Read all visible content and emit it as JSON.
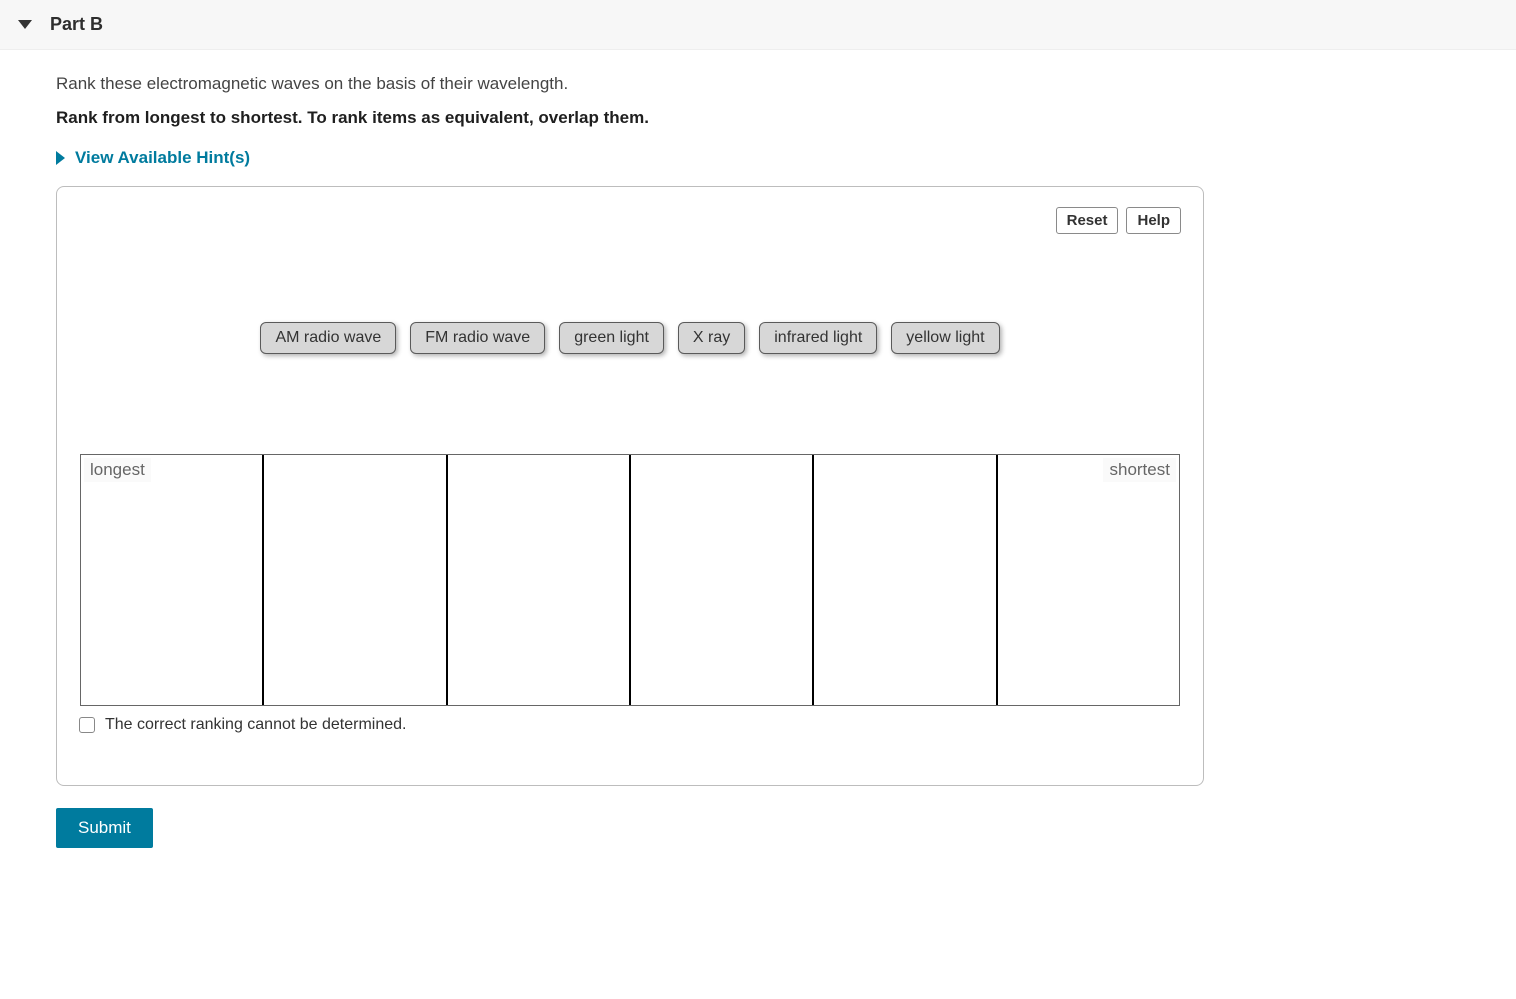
{
  "part": {
    "title": "Part B"
  },
  "question": {
    "prompt": "Rank these electromagnetic waves on the basis of their wavelength.",
    "instruction": "Rank from longest to shortest. To rank items as equivalent, overlap them."
  },
  "hints": {
    "label": "View Available Hint(s)"
  },
  "toolbar": {
    "reset": "Reset",
    "help": "Help"
  },
  "items": [
    "AM radio wave",
    "FM radio wave",
    "green light",
    "X ray",
    "infrared light",
    "yellow light"
  ],
  "ranking": {
    "left_label": "longest",
    "right_label": "shortest",
    "slots": 6
  },
  "checkbox": {
    "label": "The correct ranking cannot be determined."
  },
  "submit": {
    "label": "Submit"
  }
}
